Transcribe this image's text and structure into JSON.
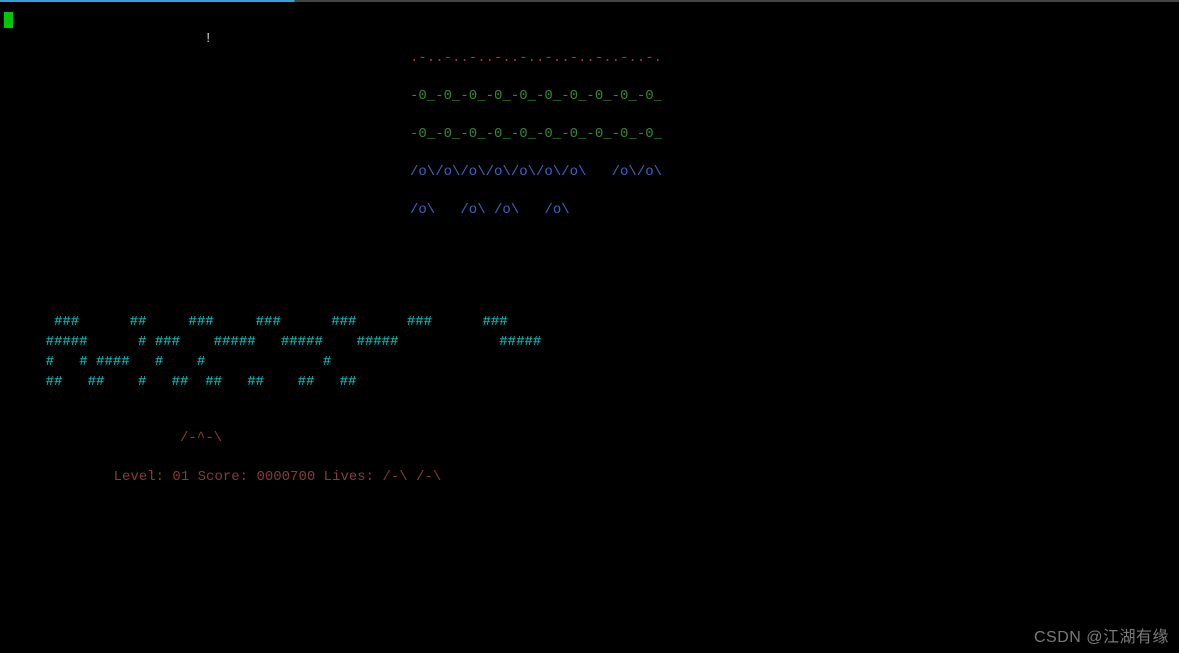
{
  "game": {
    "bullet": "!",
    "mothership_row": ".-..-..-..-..-..-..-..-..-..-.",
    "alien_row_a": "-0_-0_-0_-0_-0_-0_-0_-0_-0_-0_",
    "alien_row_b": "-0_-0_-0_-0_-0_-0_-0_-0_-0_-0_",
    "alien_row_c": "/o\\/o\\/o\\/o\\/o\\/o\\/o\\   /o\\/o\\",
    "alien_row_d": "/o\\   /o\\ /o\\   /o\\",
    "shields": {
      "l1": "     ###      ##     ###     ###      ###      ###      ###",
      "l2": "    #####      # ###    #####   #####    #####            #####",
      "l3": "    #   # ####   #    #              #",
      "l4": "    ##   ##    #   ##  ##   ##    ##   ##"
    },
    "player_ship": "/-^-\\",
    "status": {
      "level_label": "Level: ",
      "level_value": "01",
      "score_label": " Score: ",
      "score_value": "0000700",
      "lives_label": " Lives: ",
      "lives_value": "/-\\ /-\\"
    }
  },
  "watermark": "CSDN @江湖有缘",
  "chart_data": {
    "type": "table",
    "title": "nInvaders game state",
    "level": 1,
    "score": 700,
    "lives": 2,
    "aliens": {
      "mothership_row_count": 10,
      "green_row_1_count": 10,
      "green_row_2_count": 10,
      "blue_row_1_count": 9,
      "blue_row_2_count": 4
    },
    "shields_present": 7,
    "player_x_column_approx": 23
  }
}
